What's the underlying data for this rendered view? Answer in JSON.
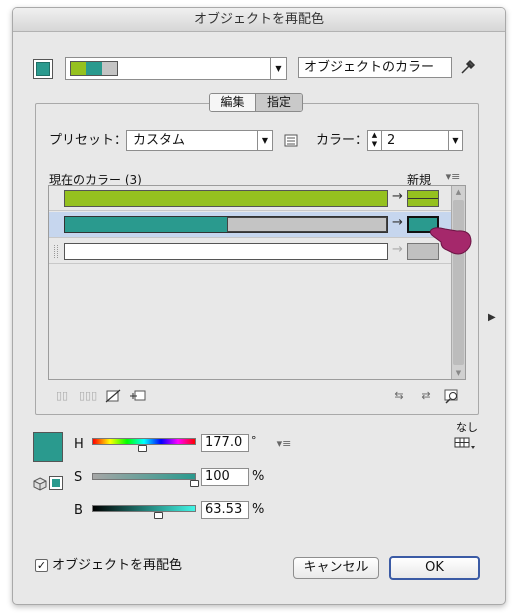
{
  "window": {
    "title": "オブジェクトを再配色"
  },
  "top": {
    "color_name_value": "オブジェクトのカラー"
  },
  "tabs": [
    {
      "label": "編集"
    },
    {
      "label": "指定"
    }
  ],
  "preset": {
    "label": "プリセット：",
    "value": "カスタム"
  },
  "colors_count": {
    "label": "カラー：",
    "value": "2"
  },
  "table": {
    "current_header": "現在のカラー (3)",
    "new_header": "新規",
    "rows": [
      {
        "current": "#95c11f",
        "new": "#95c11f",
        "selected": false
      },
      {
        "current": "#2a9a8e",
        "current2": "#c4c4c4",
        "new": "#2a9a8e",
        "selected": true
      },
      {
        "current": "#ffffff",
        "new": "#c0c0c0",
        "selected": false
      }
    ]
  },
  "hsb": {
    "h_label": "H",
    "h_value": "177.0",
    "h_unit": "°",
    "s_label": "S",
    "s_value": "100",
    "s_unit": "%",
    "b_label": "B",
    "b_value": "63.53",
    "b_unit": "%",
    "h_fraction": 0.49,
    "s_fraction": 1.0,
    "b_fraction": 0.6353
  },
  "none_label": "なし",
  "recolor_checkbox": {
    "label": "オブジェクトを再配色",
    "checked": true
  },
  "buttons": {
    "cancel": "キャンセル",
    "ok": "OK"
  },
  "colors": {
    "accent_teal": "#2a9a8e",
    "green": "#95c11f",
    "cursor": "#a5286b",
    "selection": "#c6d6ee"
  }
}
